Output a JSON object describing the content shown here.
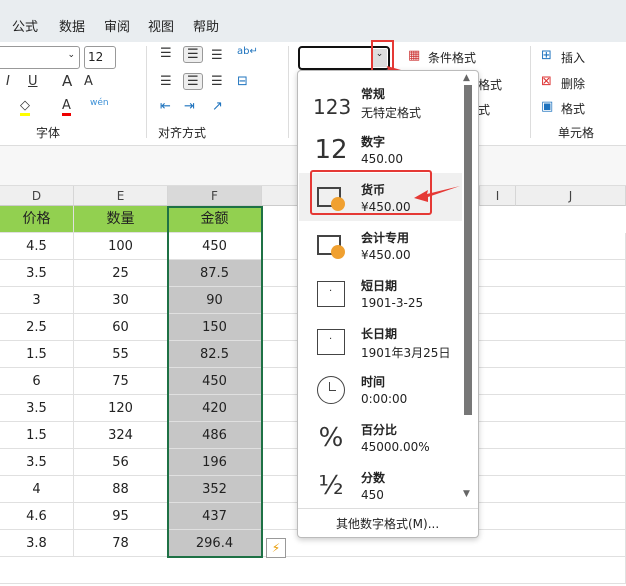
{
  "tabs": [
    "公式",
    "数据",
    "审阅",
    "视图",
    "帮助"
  ],
  "ribbon": {
    "font_size": "12",
    "font_group": "字体",
    "align_group": "对齐方式",
    "cond_format": "条件格式",
    "table_format_partial": "格式",
    "cell_style_partial": "式",
    "insert": "插入",
    "delete": "删除",
    "format": "格式",
    "cells_group": "单元格",
    "number_format_value": ""
  },
  "columns": [
    "D",
    "E",
    "F",
    "I",
    "J"
  ],
  "table": {
    "headers": [
      "价格",
      "数量",
      "金额"
    ],
    "rows": [
      [
        "4.5",
        "100",
        "450"
      ],
      [
        "3.5",
        "25",
        "87.5"
      ],
      [
        "3",
        "30",
        "90"
      ],
      [
        "2.5",
        "60",
        "150"
      ],
      [
        "1.5",
        "55",
        "82.5"
      ],
      [
        "6",
        "75",
        "450"
      ],
      [
        "3.5",
        "120",
        "420"
      ],
      [
        "1.5",
        "324",
        "486"
      ],
      [
        "3.5",
        "56",
        "196"
      ],
      [
        "4",
        "88",
        "352"
      ],
      [
        "4.6",
        "95",
        "437"
      ],
      [
        "3.8",
        "78",
        "296.4"
      ]
    ]
  },
  "dropdown": {
    "items": [
      {
        "name": "常规",
        "sample": "无特定格式",
        "icon": "clock-123-icon",
        "glyph": "123"
      },
      {
        "name": "数字",
        "sample": "450.00",
        "icon": "number-icon",
        "glyph": "12"
      },
      {
        "name": "货币",
        "sample": "¥450.00",
        "icon": "currency-icon",
        "glyph": ""
      },
      {
        "name": "会计专用",
        "sample": " ¥450.00",
        "icon": "accounting-icon",
        "glyph": ""
      },
      {
        "name": "短日期",
        "sample": "1901-3-25",
        "icon": "calendar-icon",
        "glyph": ""
      },
      {
        "name": "长日期",
        "sample": "1901年3月25日",
        "icon": "calendar-icon",
        "glyph": ""
      },
      {
        "name": "时间",
        "sample": "0:00:00",
        "icon": "clock-icon",
        "glyph": ""
      },
      {
        "name": "百分比",
        "sample": "45000.00%",
        "icon": "percent-icon",
        "glyph": "%"
      },
      {
        "name": "分数",
        "sample": "450",
        "icon": "fraction-icon",
        "glyph": "½"
      }
    ],
    "more": "其他数字格式(M)..."
  },
  "colors": {
    "header_green": "#92d050",
    "selected_gray": "#c6c6c6",
    "highlight_red": "#e53935"
  }
}
